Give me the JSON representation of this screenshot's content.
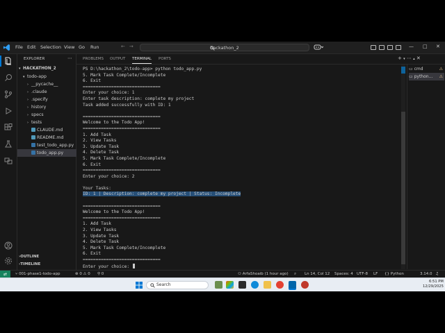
{
  "titlebar": {
    "menus": [
      "File",
      "Edit",
      "Selection",
      "View",
      "Go",
      "Run",
      "…"
    ],
    "search_text": "hackathon_2",
    "window_controls": [
      "—",
      "□",
      "✕"
    ]
  },
  "activity_icons": [
    "explorer-icon",
    "search-icon",
    "source-control-icon",
    "run-debug-icon",
    "extensions-icon",
    "testing-icon",
    "remote-explorer-icon",
    "account-icon",
    "settings-gear-icon"
  ],
  "sidebar": {
    "header": "EXPLORER",
    "root": "HACKATHON_2",
    "items": [
      {
        "label": "todo-app",
        "kind": "folder-open",
        "indent": 1
      },
      {
        "label": "__pycache__",
        "kind": "folder",
        "indent": 2
      },
      {
        "label": ".claude",
        "kind": "folder",
        "indent": 2
      },
      {
        "label": ".specify",
        "kind": "folder",
        "indent": 2
      },
      {
        "label": "history",
        "kind": "folder",
        "indent": 2
      },
      {
        "label": "specs",
        "kind": "folder",
        "indent": 2
      },
      {
        "label": "tests",
        "kind": "folder",
        "indent": 2
      },
      {
        "label": "CLAUDE.md",
        "kind": "md",
        "indent": 2
      },
      {
        "label": "README.md",
        "kind": "md",
        "indent": 2
      },
      {
        "label": "test_todo_app.py",
        "kind": "py",
        "indent": 2
      },
      {
        "label": "todo_app.py",
        "kind": "py",
        "indent": 2,
        "selected": true
      }
    ],
    "outline": "OUTLINE",
    "timeline": "TIMELINE"
  },
  "panel": {
    "tabs": [
      "PROBLEMS",
      "OUTPUT",
      "TERMINAL",
      "PORTS"
    ],
    "active_tab": "TERMINAL",
    "terminals": [
      "cmd",
      "python..."
    ]
  },
  "terminal": {
    "lines": [
      "PS D:\\hackathon_2\\todo-app> python todo_app.py",
      "5. Mark Task Complete/Incomplete",
      "6. Exit",
      "==============================",
      "Enter your choice: 1",
      "Enter task description: complete my project",
      "Task added successfully with ID: 1",
      "",
      "==============================",
      "Welcome to the Todo App!",
      "==============================",
      "1. Add Task",
      "2. View Tasks",
      "3. Update Task",
      "4. Delete Task",
      "5. Mark Task Complete/Incomplete",
      "6. Exit",
      "==============================",
      "Enter your choice: 2",
      "",
      "Your Tasks:",
      "ID: 1 | Description: complete my project | Status: Incomplete",
      "",
      "==============================",
      "Welcome to the Todo App!",
      "==============================",
      "1. Add Task",
      "2. View Tasks",
      "3. Update Task",
      "4. Delete Task",
      "5. Mark Task Complete/Incomplete",
      "6. Exit",
      "==============================",
      "Enter your choice: "
    ],
    "highlight_line": 21
  },
  "statusbar": {
    "branch": "001-phase1-todo-app",
    "problems": "⊗ 0 ⚠ 0",
    "ports": "0",
    "blame": "ArfaShoaib (1 hour ago)",
    "position": "Ln 14, Col 12",
    "spaces": "Spaces: 4",
    "encoding": "UTF-8",
    "eol": "LF",
    "language": "Python",
    "interpreter": "3.14.0"
  },
  "taskbar": {
    "search_placeholder": "Search",
    "time": "6:51 PM",
    "date": "12/29/2025"
  },
  "colors": {
    "editor_bg": "#1f1f1f",
    "sidebar_bg": "#181818",
    "selection": "#264f78",
    "accent": "#0078d4",
    "text": "#cccccc"
  }
}
